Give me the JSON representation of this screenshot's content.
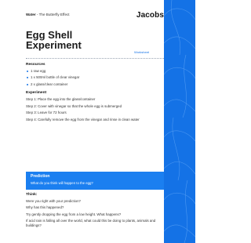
{
  "header": {
    "topic_bold": "Water",
    "topic_rest": " - The Butterfly Effect",
    "brand": "Jacobs"
  },
  "title": {
    "line1": "Egg Shell",
    "line2": "Experiment",
    "badge": "Worksheet"
  },
  "resources": {
    "heading": "Resources",
    "items": [
      "1 raw egg",
      "1 x 500ml bottle of clear vinegar",
      "2 x glass/clear container"
    ]
  },
  "experiment": {
    "heading": "Experiment",
    "steps": [
      "Step 1: Place the egg into the glass/container",
      "Step 2: Cover with vinegar so that the whole egg is submerged",
      "Step 3: Leave for 72 hours",
      "Step 4: Carefully remove the egg from the vinegar and rinse in clean water"
    ]
  },
  "prediction": {
    "heading": "Prediction",
    "question": "What do you think will happen to the egg?"
  },
  "think": {
    "heading": "Think:",
    "questions": [
      "Were you right with your prediction?",
      "Why has this happened?",
      "Try gently dropping the egg from a low height. What happens?",
      "If acid rain is falling all over the world, what could this be doing to plants, animals and buildings?"
    ]
  },
  "colors": {
    "accent": "#1472e6",
    "prediction_bg": "#1b7ff0"
  }
}
